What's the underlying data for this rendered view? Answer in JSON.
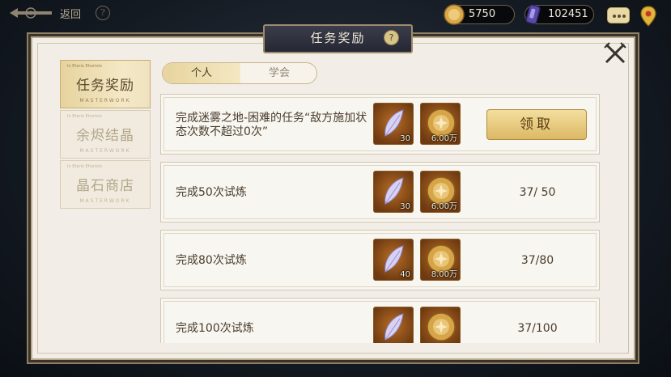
{
  "topbar": {
    "back_label": "返回",
    "help_symbol": "?",
    "gold_amount": "5750",
    "crystal_amount": "102451"
  },
  "panel": {
    "title": "任务奖励",
    "help_symbol": "?"
  },
  "side_nav": [
    {
      "label": "任务奖励",
      "top_text": "In Eterio Ehoriolo",
      "sub_text": "MASTERWORK",
      "active": true
    },
    {
      "label": "余烬结晶",
      "top_text": "In Eterio Ehoriolo",
      "sub_text": "MASTERWORK",
      "active": false
    },
    {
      "label": "晶石商店",
      "top_text": "In Eterio Ehoriolo",
      "sub_text": "MASTERWORK",
      "active": false
    }
  ],
  "tabs": [
    {
      "label": "个人",
      "active": true
    },
    {
      "label": "学会",
      "active": false
    }
  ],
  "tasks": [
    {
      "desc": "完成迷雾之地-困难的任务“敌方施加状态次数不超过0次”",
      "reward1_qty": "30",
      "reward2_qty": "6.00万",
      "action": "领取",
      "progress": ""
    },
    {
      "desc": "完成50次试炼",
      "reward1_qty": "30",
      "reward2_qty": "6.00万",
      "action": "",
      "progress": "37/ 50"
    },
    {
      "desc": "完成80次试炼",
      "reward1_qty": "40",
      "reward2_qty": "8.00万",
      "action": "",
      "progress": "37/80"
    },
    {
      "desc": "完成100次试炼",
      "reward1_qty": "",
      "reward2_qty": "",
      "action": "",
      "progress": "37/100"
    }
  ],
  "icons": {
    "back": "ornate-back-arrow-icon",
    "gold": "gold-coin-icon",
    "crystal": "purple-crystal-icon",
    "chat": "chat-bubble-icon",
    "map": "map-pin-icon",
    "close": "crossed-swords-close-icon",
    "reward1": "feather-crystal-icon",
    "reward2": "gold-coin-icon"
  },
  "colors": {
    "accent_gold": "#dcb865",
    "panel_bg": "#f2eee7",
    "title_plate": "#2f303d"
  }
}
